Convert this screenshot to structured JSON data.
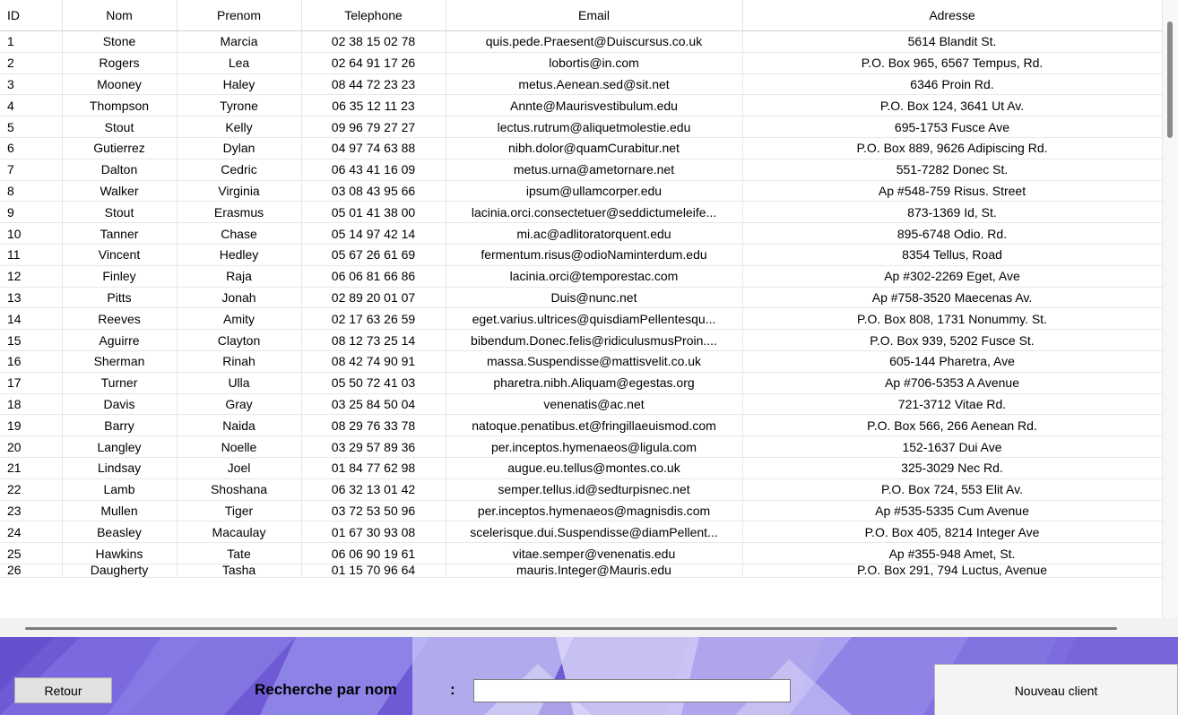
{
  "grid": {
    "columns": [
      "ID",
      "Nom",
      "Prenom",
      "Telephone",
      "Email",
      "Adresse"
    ],
    "rows": [
      [
        "1",
        "Stone",
        "Marcia",
        "02 38 15 02 78",
        "quis.pede.Praesent@Duiscursus.co.uk",
        "5614 Blandit St."
      ],
      [
        "2",
        "Rogers",
        "Lea",
        "02 64 91 17 26",
        "lobortis@in.com",
        "P.O. Box 965, 6567 Tempus, Rd."
      ],
      [
        "3",
        "Mooney",
        "Haley",
        "08 44 72 23 23",
        "metus.Aenean.sed@sit.net",
        "6346 Proin Rd."
      ],
      [
        "4",
        "Thompson",
        "Tyrone",
        "06 35 12 11 23",
        "Annte@Maurisvestibulum.edu",
        "P.O. Box 124, 3641 Ut Av."
      ],
      [
        "5",
        "Stout",
        "Kelly",
        "09 96 79 27 27",
        "lectus.rutrum@aliquetmolestie.edu",
        "695-1753 Fusce Ave"
      ],
      [
        "6",
        "Gutierrez",
        "Dylan",
        "04 97 74 63 88",
        "nibh.dolor@quamCurabitur.net",
        "P.O. Box 889, 9626 Adipiscing Rd."
      ],
      [
        "7",
        "Dalton",
        "Cedric",
        "06 43 41 16 09",
        "metus.urna@ametornare.net",
        "551-7282 Donec St."
      ],
      [
        "8",
        "Walker",
        "Virginia",
        "03 08 43 95 66",
        "ipsum@ullamcorper.edu",
        "Ap #548-759 Risus. Street"
      ],
      [
        "9",
        "Stout",
        "Erasmus",
        "05 01 41 38 00",
        "lacinia.orci.consectetuer@seddictumeleife...",
        "873-1369 Id, St."
      ],
      [
        "10",
        "Tanner",
        "Chase",
        "05 14 97 42 14",
        "mi.ac@adlitoratorquent.edu",
        "895-6748 Odio. Rd."
      ],
      [
        "11",
        "Vincent",
        "Hedley",
        "05 67 26 61 69",
        "fermentum.risus@odioNaminterdum.edu",
        "8354 Tellus, Road"
      ],
      [
        "12",
        "Finley",
        "Raja",
        "06 06 81 66 86",
        "lacinia.orci@temporestac.com",
        "Ap #302-2269 Eget, Ave"
      ],
      [
        "13",
        "Pitts",
        "Jonah",
        "02 89 20 01 07",
        "Duis@nunc.net",
        "Ap #758-3520 Maecenas Av."
      ],
      [
        "14",
        "Reeves",
        "Amity",
        "02 17 63 26 59",
        "eget.varius.ultrices@quisdiamPellentesqu...",
        "P.O. Box 808, 1731 Nonummy. St."
      ],
      [
        "15",
        "Aguirre",
        "Clayton",
        "08 12 73 25 14",
        "bibendum.Donec.felis@ridiculusmusProin....",
        "P.O. Box 939, 5202 Fusce St."
      ],
      [
        "16",
        "Sherman",
        "Rinah",
        "08 42 74 90 91",
        "massa.Suspendisse@mattisvelit.co.uk",
        "605-144 Pharetra, Ave"
      ],
      [
        "17",
        "Turner",
        "Ulla",
        "05 50 72 41 03",
        "pharetra.nibh.Aliquam@egestas.org",
        "Ap #706-5353 A Avenue"
      ],
      [
        "18",
        "Davis",
        "Gray",
        "03 25 84 50 04",
        "venenatis@ac.net",
        "721-3712 Vitae Rd."
      ],
      [
        "19",
        "Barry",
        "Naida",
        "08 29 76 33 78",
        "natoque.penatibus.et@fringillaeuismod.com",
        "P.O. Box 566, 266 Aenean Rd."
      ],
      [
        "20",
        "Langley",
        "Noelle",
        "03 29 57 89 36",
        "per.inceptos.hymenaeos@ligula.com",
        "152-1637 Dui Ave"
      ],
      [
        "21",
        "Lindsay",
        "Joel",
        "01 84 77 62 98",
        "augue.eu.tellus@montes.co.uk",
        "325-3029 Nec Rd."
      ],
      [
        "22",
        "Lamb",
        "Shoshana",
        "06 32 13 01 42",
        "semper.tellus.id@sedturpisnec.net",
        "P.O. Box 724, 553 Elit Av."
      ],
      [
        "23",
        "Mullen",
        "Tiger",
        "03 72 53 50 96",
        "per.inceptos.hymenaeos@magnisdis.com",
        "Ap #535-5335 Cum Avenue"
      ],
      [
        "24",
        "Beasley",
        "Macaulay",
        "01 67 30 93 08",
        "scelerisque.dui.Suspendisse@diamPellent...",
        "P.O. Box 405, 8214 Integer Ave"
      ],
      [
        "25",
        "Hawkins",
        "Tate",
        "06 06 90 19 61",
        "vitae.semper@venenatis.edu",
        "Ap #355-948 Amet, St."
      ],
      [
        "26",
        "Daugherty",
        "Tasha",
        "01 15 70 96 64",
        "mauris.Integer@Mauris.edu",
        "P.O. Box 291, 794 Luctus, Avenue"
      ]
    ]
  },
  "footer": {
    "back_label": "Retour",
    "search_label": "Recherche par nom",
    "search_colon": ":",
    "search_value": "",
    "new_client_label": "Nouveau client"
  },
  "colors": {
    "footer_purple": "#6f5bd7",
    "footer_light": "#b7b2ee",
    "grid_bg": "#ffffff"
  }
}
